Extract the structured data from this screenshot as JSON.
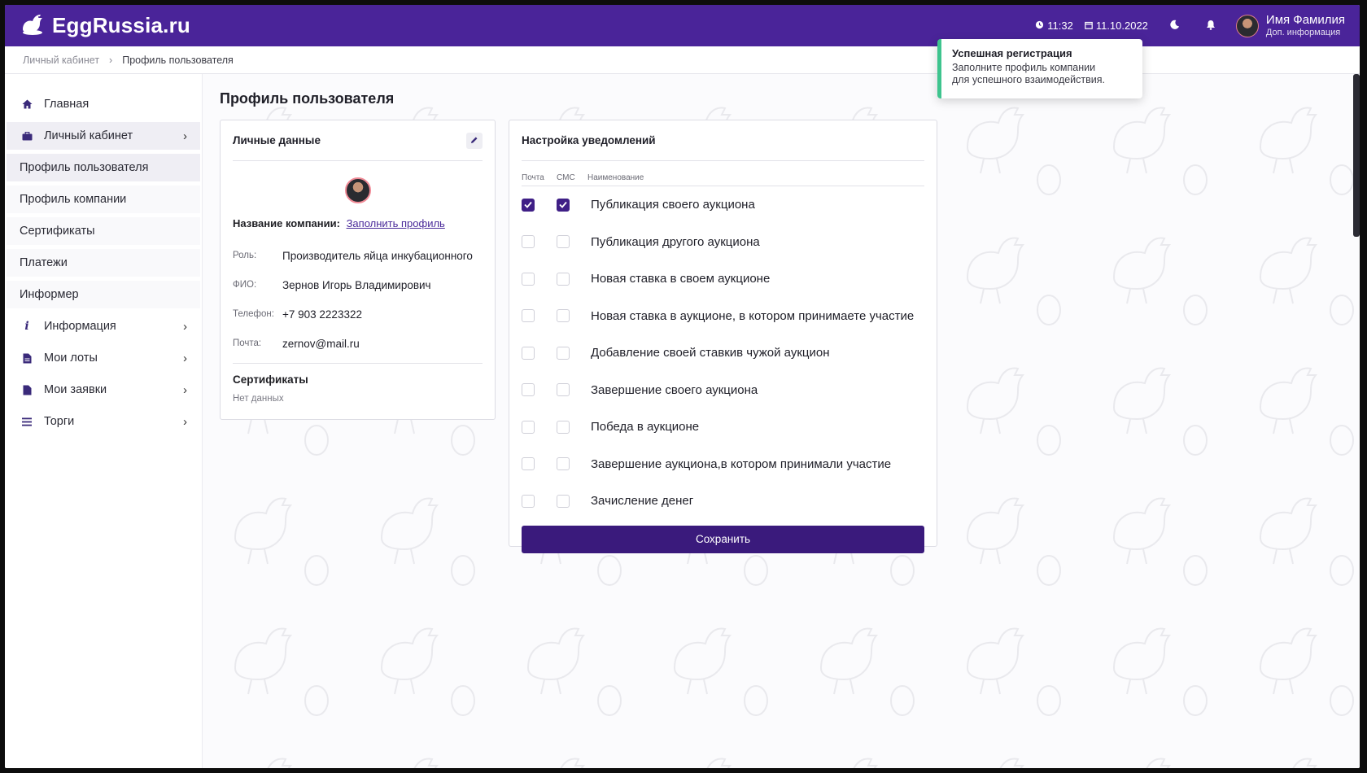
{
  "brand": {
    "name": "EggRussia.ru",
    "icon": "hen-logo-icon"
  },
  "header": {
    "time": "11:32",
    "date": "11.10.2022",
    "user_name": "Имя Фамилия",
    "user_sub": "Доп. информация",
    "accent": "#4a2499"
  },
  "breadcrumb": {
    "root": "Личный кабинет",
    "current": "Профиль пользователя"
  },
  "sidebar": {
    "items": [
      {
        "label": "Главная",
        "icon": "home-icon"
      },
      {
        "label": "Личный кабинет",
        "icon": "briefcase-icon"
      },
      {
        "label": "Профиль пользователя"
      },
      {
        "label": "Профиль компании"
      },
      {
        "label": "Сертификаты"
      },
      {
        "label": "Платежи"
      },
      {
        "label": "Информер"
      },
      {
        "label": "Информация",
        "icon": "info-icon"
      },
      {
        "label": "Мои лоты",
        "icon": "document-icon"
      },
      {
        "label": "Мои заявки",
        "icon": "file-icon"
      },
      {
        "label": "Торги",
        "icon": "list-icon"
      }
    ]
  },
  "page": {
    "title": "Профиль пользователя"
  },
  "personal": {
    "title": "Личные данные",
    "company_label": "Название компании:",
    "company_link": "Заполнить профиль",
    "fields": [
      {
        "key": "Роль:",
        "value": "Производитель яйца инкубационного"
      },
      {
        "key": "ФИО:",
        "value": "Зернов Игорь Владимирович"
      },
      {
        "key": "Телефон:",
        "value": "+7 903 2223322"
      },
      {
        "key": "Почта:",
        "value": "zernov@mail.ru"
      }
    ],
    "cert_title": "Сертификаты",
    "cert_empty": "Нет данных"
  },
  "notifications": {
    "title": "Настройка уведомлений",
    "col_mail": "Почта",
    "col_sms": "СМС",
    "col_name": "Наименование",
    "rows": [
      {
        "label": "Публикация своего аукциона",
        "mail": true,
        "sms": true
      },
      {
        "label": "Публикация другого аукциона",
        "mail": false,
        "sms": false
      },
      {
        "label": "Новая ставка в своем аукционе",
        "mail": false,
        "sms": false
      },
      {
        "label": "Новая ставка в аукционе, в котором принимаете участие",
        "mail": false,
        "sms": false
      },
      {
        "label": "Добавление своей ставкив чужой аукцион",
        "mail": false,
        "sms": false
      },
      {
        "label": "Завершение своего аукциона",
        "mail": false,
        "sms": false
      },
      {
        "label": "Победа в аукционе",
        "mail": false,
        "sms": false
      },
      {
        "label": "Завершение аукциона,в котором принимали участие",
        "mail": false,
        "sms": false
      },
      {
        "label": "Зачисление денег",
        "mail": false,
        "sms": false
      }
    ],
    "save_label": "Сохранить"
  },
  "toast": {
    "title": "Успешная регистрация",
    "line1": "Заполните профиль компании",
    "line2": "для успешного взаимодействия.",
    "color": "#3ec48e"
  }
}
